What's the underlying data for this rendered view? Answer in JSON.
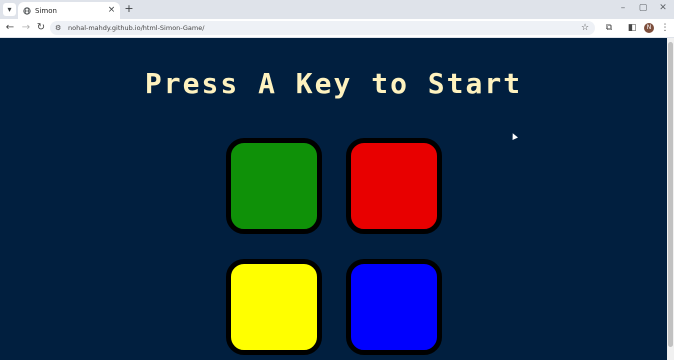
{
  "browser": {
    "tab": {
      "title": "Simon",
      "favicon": "globe-icon"
    },
    "url": "nohal-mahdy.github.io/html-Simon-Game/",
    "avatar_letter": "N"
  },
  "page": {
    "level_title": "Press A Key to Start",
    "background": "#011f3f",
    "title_color": "#fef2bf",
    "buttons": [
      {
        "id": "green",
        "color": "#0f9108"
      },
      {
        "id": "red",
        "color": "#e80000"
      },
      {
        "id": "yellow",
        "color": "#ffff00"
      },
      {
        "id": "blue",
        "color": "#0000ff"
      }
    ]
  }
}
